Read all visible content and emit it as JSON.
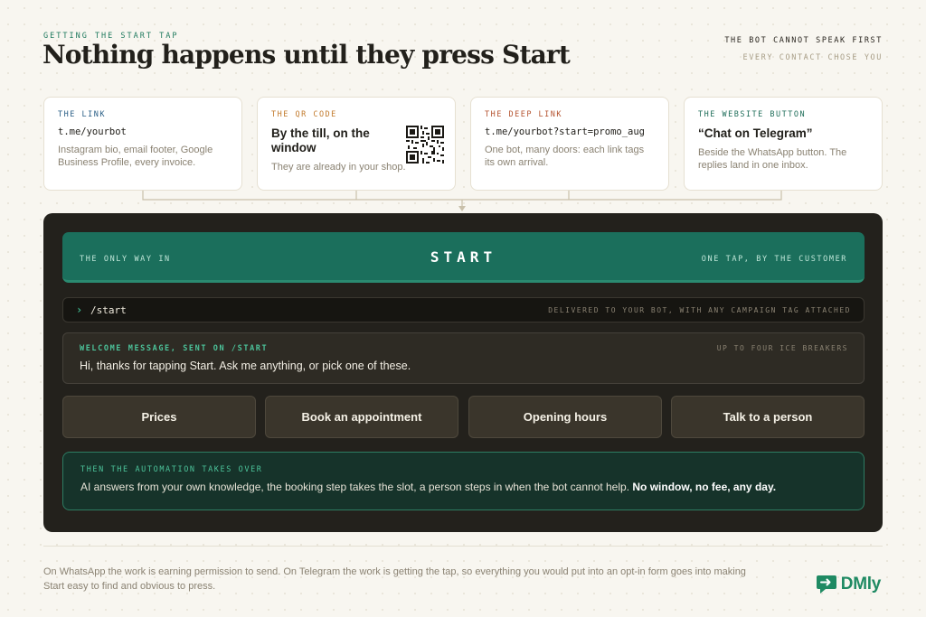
{
  "header": {
    "kicker": "GETTING THE START TAP",
    "title": "Nothing happens until they press Start",
    "tagline": "THE BOT CANNOT SPEAK FIRST",
    "subtagline": "EVERY CONTACT CHOSE YOU"
  },
  "cards": [
    {
      "label": "THE LINK",
      "label_color": "#2a5e86",
      "code": "t.me/yourbot",
      "desc": "Instagram bio, email footer, Google Business Profile, every invoice."
    },
    {
      "label": "THE QR CODE",
      "label_color": "#c27a2c",
      "heading": "By the till, on the window",
      "desc": "They are already in your shop.",
      "icon": "qr-code-icon"
    },
    {
      "label": "THE DEEP LINK",
      "label_color": "#b4532f",
      "code": "t.me/yourbot?start=promo_aug",
      "desc": "One bot, many doors: each link tags its own arrival."
    },
    {
      "label": "THE WEBSITE BUTTON",
      "label_color": "#1f6e5a",
      "heading": "“Chat on Telegram”",
      "desc": "Beside the WhatsApp button. The replies land in one inbox."
    }
  ],
  "panel": {
    "start_left": "THE ONLY WAY IN",
    "start_label": "START",
    "start_right": "ONE TAP, BY THE CUSTOMER",
    "command": "/start",
    "command_note": "DELIVERED TO YOUR BOT, WITH ANY CAMPAIGN TAG ATTACHED",
    "welcome_label": "WELCOME MESSAGE, SENT ON /START",
    "welcome_note": "UP TO FOUR ICE BREAKERS",
    "welcome_text": "Hi, thanks for tapping Start. Ask me anything, or pick one of these.",
    "ice_breakers": [
      "Prices",
      "Book an appointment",
      "Opening hours",
      "Talk to a person"
    ],
    "automation_label": "THEN THE AUTOMATION TAKES OVER",
    "automation_text": "AI answers from your own knowledge, the booking step takes the slot, a person steps in when the bot cannot help.",
    "automation_emphasis": "No window, no fee, any day."
  },
  "footer": {
    "text": "On WhatsApp the work is earning permission to send. On Telegram the work is getting the tap, so everything you would put into an opt-in form goes into making Start easy to find and obvious to press.",
    "logo_text": "DMly",
    "logo_icon": "chat-bubble-icon"
  },
  "colors": {
    "accent": "#1b6f5c",
    "panel": "#23211c",
    "logo": "#1f8a63"
  }
}
